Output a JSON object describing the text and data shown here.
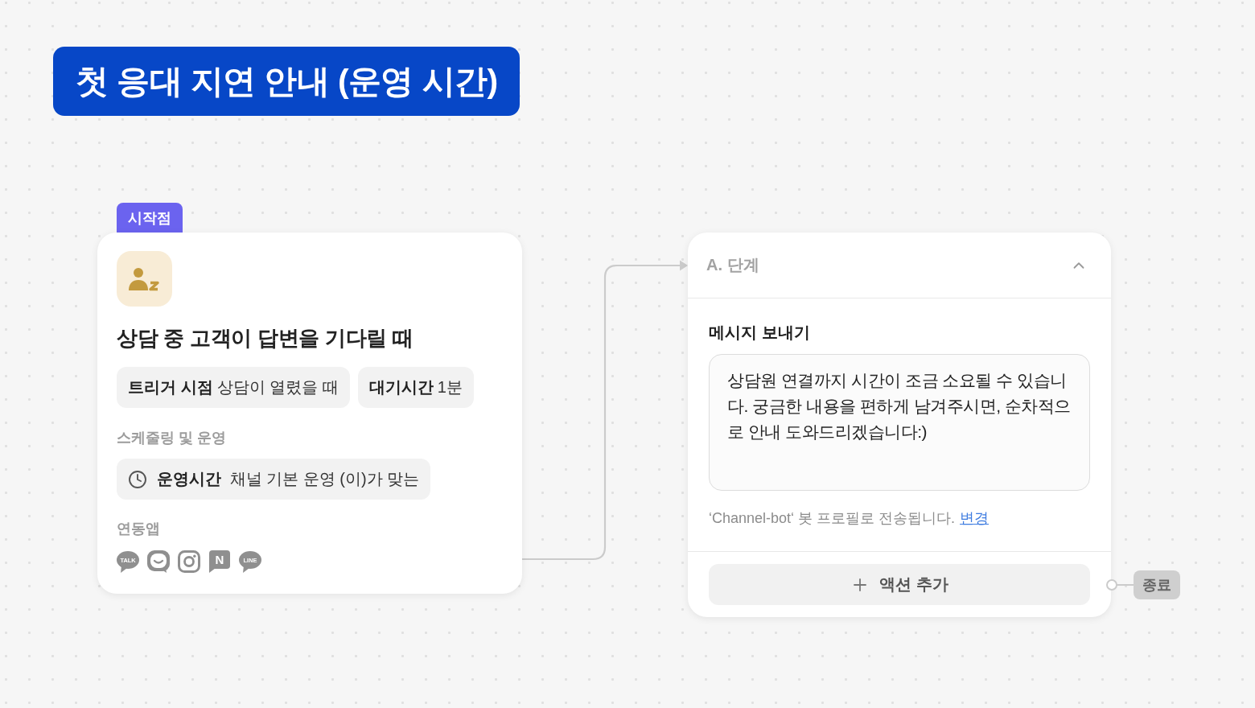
{
  "title": "첫 응대 지연 안내 (운영 시간)",
  "start_node": {
    "badge": "시작점",
    "title": "상담 중 고객이 답변을 기다릴 때",
    "conditions": [
      {
        "label": "트리거 시점",
        "value": "상담이 열렸을 때"
      },
      {
        "label": "대기시간",
        "value": "1분"
      }
    ],
    "scheduling": {
      "heading": "스케줄링 및 운영",
      "label": "운영시간",
      "value": "채널 기본 운영 (이)가 맞는"
    },
    "apps": {
      "heading": "연동앱",
      "items": [
        {
          "kind": "round-bubble",
          "label": "TALK"
        },
        {
          "kind": "smile-bubble"
        },
        {
          "kind": "camera"
        },
        {
          "kind": "square-bubble",
          "label": "N"
        },
        {
          "kind": "round-bubble",
          "label": "LINE"
        }
      ]
    }
  },
  "step_node": {
    "header": "A. 단계",
    "expanded": true,
    "action_title": "메시지 보내기",
    "message": "상담원 연결까지 시간이 조금 소요될 수 있습니다. 궁금한 내용을 편하게 남겨주시면, 순차적으로 안내 도와드리겠습니다:)",
    "sender_note": "‘Channel-bot‘ 봇 프로필로 전송됩니다.",
    "change_link": "변경",
    "add_action": "액션 추가"
  },
  "end_node": {
    "label": "종료"
  }
}
